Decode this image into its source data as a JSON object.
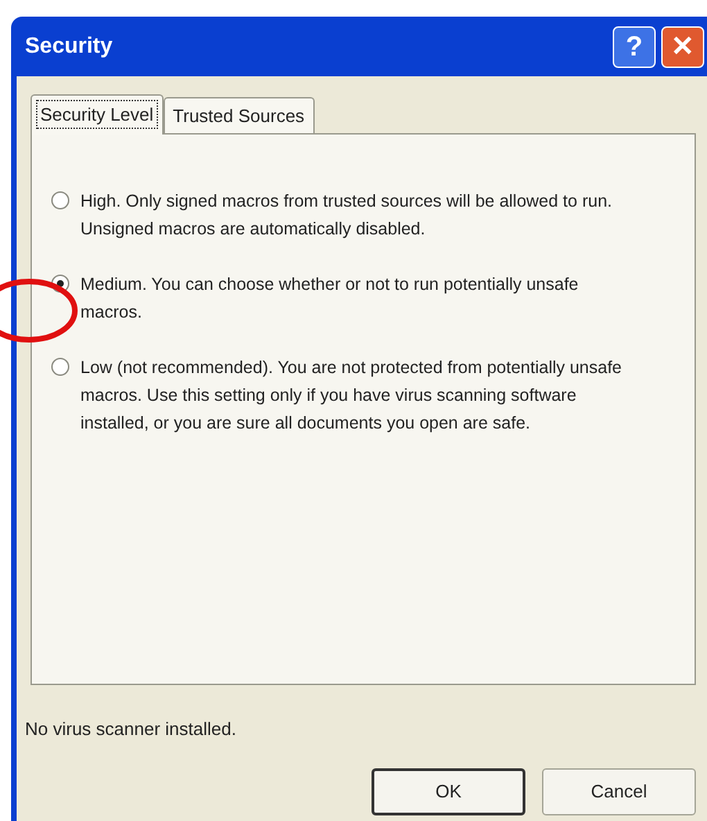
{
  "window": {
    "title": "Security"
  },
  "title_buttons": [
    {
      "kind": "help",
      "label": "?"
    },
    {
      "kind": "close",
      "label": "✕"
    }
  ],
  "tabs": [
    {
      "label": "Security Level",
      "selected": true
    },
    {
      "label": "Trusted Sources",
      "selected": false
    }
  ],
  "options": [
    {
      "text": "High. Only signed macros from trusted sources will be allowed to run. Unsigned macros are automatically disabled.",
      "selected": false
    },
    {
      "text": "Medium. You can choose whether or not to run potentially unsafe macros.",
      "selected": true
    },
    {
      "text": "Low (not recommended). You are not protected from potentially unsafe macros. Use this setting only if you have virus scanning software installed, or you are sure all documents you open are safe.",
      "selected": false
    }
  ],
  "status": "No virus scanner installed.",
  "buttons": [
    {
      "label": "OK",
      "default": true
    },
    {
      "label": "Cancel",
      "default": false
    }
  ]
}
